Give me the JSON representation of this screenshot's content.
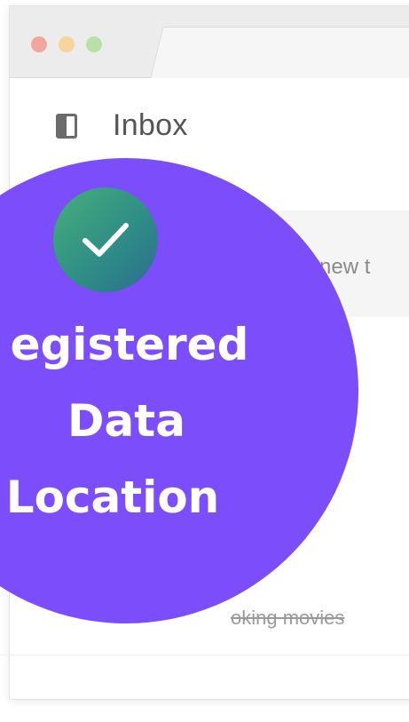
{
  "window": {
    "traffic_lights": [
      "close",
      "minimize",
      "zoom"
    ]
  },
  "header": {
    "sidebar_icon": "sidebar-toggle-icon",
    "title": "Inbox"
  },
  "compose": {
    "text": "e new t"
  },
  "list": {
    "row_text": "oking movies"
  },
  "overlay": {
    "icon": "checkmark-icon",
    "line1": "egistered",
    "line2": "Data",
    "line3": "Location",
    "circle_color": "#7b4dfb",
    "badge_gradient": [
      "#46b07a",
      "#2b6d8e"
    ]
  }
}
